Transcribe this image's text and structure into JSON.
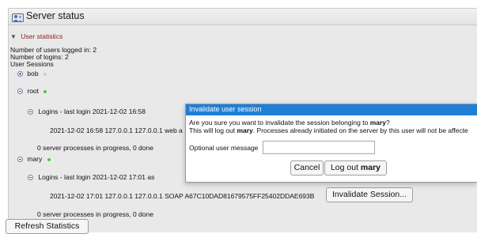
{
  "window": {
    "title": "Server status"
  },
  "stats": {
    "section_label": "User statistics",
    "users_logged_in": "Number of users logged in: 2",
    "logins": "Number of logins: 2",
    "sessions_label": "User Sessions"
  },
  "users": {
    "bob": {
      "name": "bob",
      "status_color": "#cfcfcf"
    },
    "root": {
      "name": "root",
      "status_color": "#59c14c",
      "logins_label": "Logins - last login 2021-12-02 16:58",
      "session_line": "2021-12-02 16:58 127.0.0.1 127.0.0.1 web a",
      "processes": "0 server processes in progress, 0 done"
    },
    "mary": {
      "name": "mary",
      "status_color": "#59c14c",
      "logins_label": "Logins - last login 2021-12-02 17:01 as",
      "session_line": "2021-12-02 17:01 127.0.0.1 127.0.0.1 SOAP A67C10DAD81679575FF25402DDAE693B",
      "invalidate_label": "Invalidate Session...",
      "processes": "0 server processes in progress, 0 done"
    }
  },
  "footer": {
    "refresh_label": "Refresh Statistics"
  },
  "dialog": {
    "title": "Invalidate user session",
    "line1_prefix": "Are you sure you want to invalidate the session belonging to ",
    "user": "mary",
    "line1_suffix": "?",
    "line2_prefix": "This will log out ",
    "line2_suffix": ". Processes already initiated on the server by this user will not be affecte",
    "message_label": "Optional user message",
    "message_value": "",
    "cancel_label": "Cancel",
    "logout_prefix": "Log out "
  }
}
